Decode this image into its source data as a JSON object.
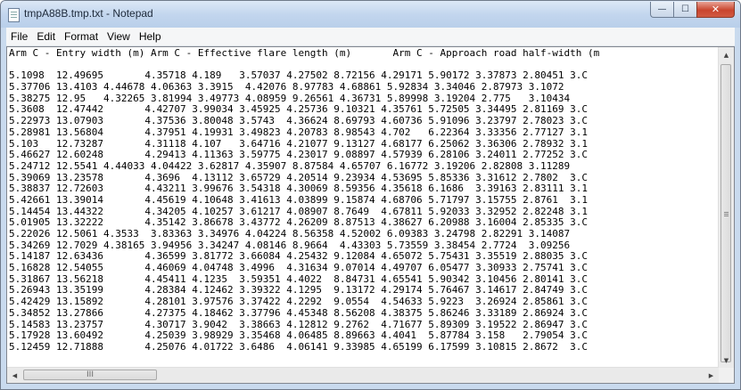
{
  "window": {
    "title": "tmpA88B.tmp.txt - Notepad",
    "icon": "notepad-icon"
  },
  "caption_buttons": {
    "minimize": "—",
    "maximize": "☐",
    "close": "✕"
  },
  "menu": [
    "File",
    "Edit",
    "Format",
    "View",
    "Help"
  ],
  "editor": {
    "lines": [
      "Arm C - Entry width (m) Arm C - Effective flare length (m)       Arm C - Approach road half-width (m",
      "",
      "5.1098  12.49695       4.35718 4.189   3.57037 4.27502 8.72156 4.29171 5.90172 3.37873 2.80451 3.C",
      "5.37706 13.4103 4.44678 4.06363 3.3915  4.42076 8.97783 4.68861 5.92834 3.34046 2.87973 3.1072",
      "5.38275 12.95   4.32265 3.81994 3.49773 4.08959 9.26561 4.36731 5.89998 3.19204 2.775   3.10434",
      "5.3608  12.47442       4.42707 3.99034 3.45925 4.25736 9.10321 4.35761 5.72505 3.34495 2.81169 3.C",
      "5.22973 13.07903       4.37536 3.80048 3.5743  4.36624 8.69793 4.60736 5.91096 3.23797 2.78023 3.C",
      "5.28981 13.56804       4.37951 4.19931 3.49823 4.20783 8.98543 4.702   6.22364 3.33356 2.77127 3.1",
      "5.103   12.73287       4.31118 4.107   3.64716 4.21077 9.13127 4.68177 6.25062 3.36306 2.78932 3.1",
      "5.46627 12.60248       4.29413 4.11363 3.59775 4.23017 9.08897 4.57939 6.28106 3.24011 2.77252 3.C",
      "5.24712 12.5541 4.44033 4.04422 3.62817 4.35907 8.87584 4.65707 6.16772 3.19206 2.82808 3.11289",
      "5.39069 13.23578       4.3696  4.13112 3.65729 4.20514 9.23934 4.53695 5.85336 3.31612 2.7802  3.C",
      "5.38837 12.72603       4.43211 3.99676 3.54318 4.30069 8.59356 4.35618 6.1686  3.39163 2.83111 3.1",
      "5.42661 13.39014       4.45619 4.10648 3.41613 4.03899 9.15874 4.68706 5.71797 3.15755 2.8761  3.1",
      "5.14454 13.44322       4.34205 4.10257 3.61217 4.08907 8.7649  4.67811 5.92033 3.32952 2.82248 3.1",
      "5.01905 13.32222       4.35142 3.86678 3.43772 4.26209 8.87513 4.38627 6.20988 3.16004 2.85335 3.C",
      "5.22026 12.5061 4.3533  3.83363 3.34976 4.04224 8.56358 4.52002 6.09383 3.24798 2.82291 3.14087",
      "5.34269 12.7029 4.38165 3.94956 3.34247 4.08146 8.9664  4.43303 5.73559 3.38454 2.7724  3.09256",
      "5.14187 12.63436       4.36599 3.81772 3.66084 4.25432 9.12084 4.65072 5.75431 3.35519 2.88035 3.C",
      "5.16828 12.54055       4.46069 4.04748 3.4996  4.31634 9.07014 4.49707 6.05477 3.30933 2.75741 3.C",
      "5.31867 13.56218       4.45411 4.1235  3.59351 4.4022  8.84731 4.65541 5.90342 3.10456 2.80141 3.C",
      "5.26943 13.35199       4.28384 4.12462 3.39322 4.1295  9.13172 4.29174 5.76467 3.14617 2.84749 3.C",
      "5.42429 13.15892       4.28101 3.97576 3.37422 4.2292  9.0554  4.54633 5.9223  3.26924 2.85861 3.C",
      "5.34852 13.27866       4.27375 4.18462 3.37796 4.45348 8.56208 4.38375 5.86246 3.33189 2.86924 3.C",
      "5.14583 13.23757       4.30717 3.9042  3.38663 4.12812 9.2762  4.71677 5.89309 3.19522 2.86947 3.C",
      "5.17928 13.60492       4.25039 3.98929 3.35468 4.06485 8.89663 4.4041  5.87784 3.158   2.79054 3.C",
      "5.12459 12.71888       4.25076 4.01722 3.6486  4.06141 9.33985 4.65199 6.17599 3.10815 2.8672  3.C"
    ]
  },
  "scrollbars": {
    "vertical": {
      "up_arrow": "▲",
      "down_arrow": "▼"
    },
    "horizontal": {
      "left_arrow": "◀",
      "right_arrow": "▶",
      "grip": "III"
    }
  }
}
